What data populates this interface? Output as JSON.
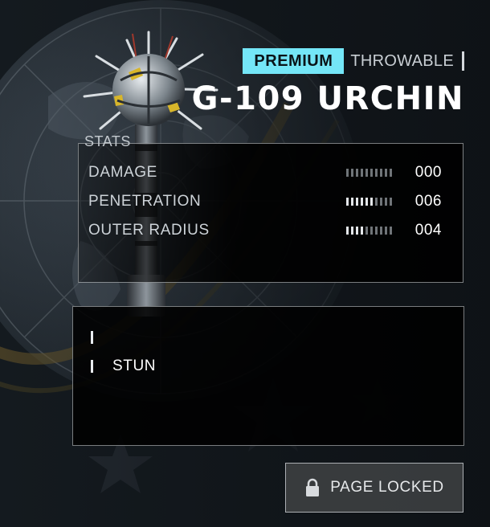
{
  "header": {
    "badge": "PREMIUM",
    "category": "THROWABLE",
    "title": "G-109 URCHIN"
  },
  "stats": {
    "label": "STATS",
    "rows": [
      {
        "name": "DAMAGE",
        "value": "000",
        "level": 0
      },
      {
        "name": "PENETRATION",
        "value": "006",
        "level": 0.6
      },
      {
        "name": "OUTER RADIUS",
        "value": "004",
        "level": 0.4
      }
    ]
  },
  "traits": [
    {
      "text": ""
    },
    {
      "text": "STUN"
    }
  ],
  "footer": {
    "locked_label": "PAGE LOCKED",
    "icon": "lock-icon"
  },
  "colors": {
    "accent": "#74e6f7",
    "background": "#0e1216",
    "panel": "#000000"
  }
}
